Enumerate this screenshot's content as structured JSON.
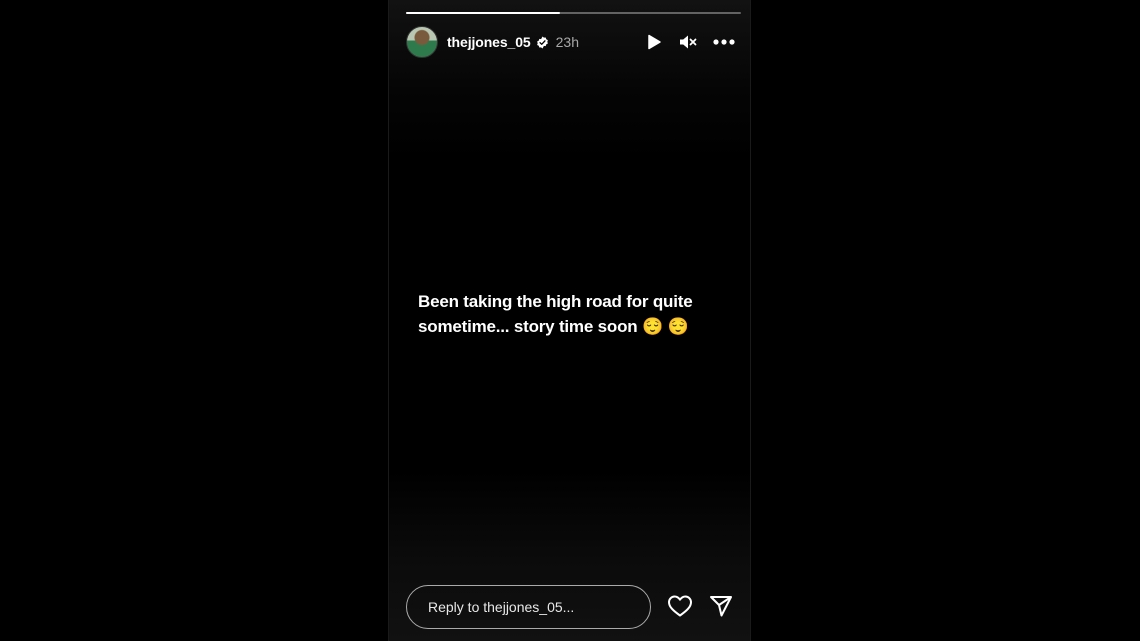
{
  "story": {
    "progress": 0.46,
    "author": {
      "username": "thejjones_05",
      "verified": true,
      "time_ago": "23h"
    },
    "controls": {
      "play_icon": "play-icon",
      "mute_icon": "speaker-muted-icon",
      "more_icon": "more-options-icon"
    },
    "caption_line1": "Been taking the high road for quite",
    "caption_line2": "sometime... story time soon 😌 😌"
  },
  "reply": {
    "placeholder": "Reply to thejjones_05..."
  },
  "actions": {
    "like_icon": "heart-icon",
    "share_icon": "send-icon"
  }
}
